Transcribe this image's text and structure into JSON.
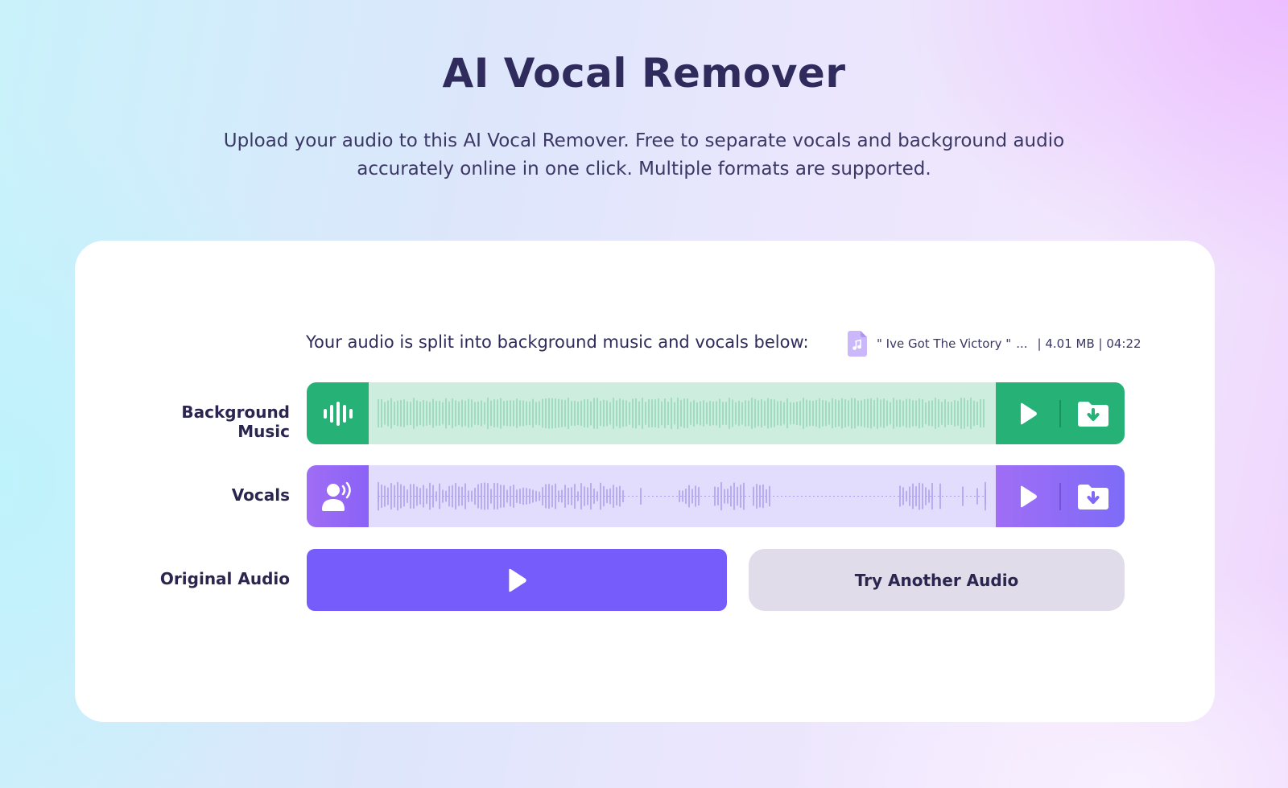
{
  "header": {
    "title": "AI Vocal Remover",
    "subtitle_line1": "Upload your audio to this AI Vocal Remover. Free to separate vocals and background audio",
    "subtitle_line2": "accurately online in one click. Multiple formats are supported."
  },
  "result": {
    "split_text": "Your audio is split into background music and vocals below:",
    "file": {
      "name": "\" Ive Got The Victory \"",
      "ellipsis": "...",
      "size_duration": "| 4.01 MB | 04:22",
      "icon": "music-file-icon"
    }
  },
  "tracks": {
    "background": {
      "label": "Background Music",
      "icon": "sound-wave-icon",
      "wave_color": "#94d8b8"
    },
    "vocals": {
      "label": "Vocals",
      "icon": "speaking-person-icon",
      "wave_color": "#ae9ff0"
    }
  },
  "original": {
    "label": "Original Audio",
    "try_another_label": "Try Another Audio"
  },
  "colors": {
    "title": "#2f2b5c",
    "accent_purple": "#765cfb",
    "accent_green": "#26b277",
    "secondary_button": "#e0dce9"
  }
}
